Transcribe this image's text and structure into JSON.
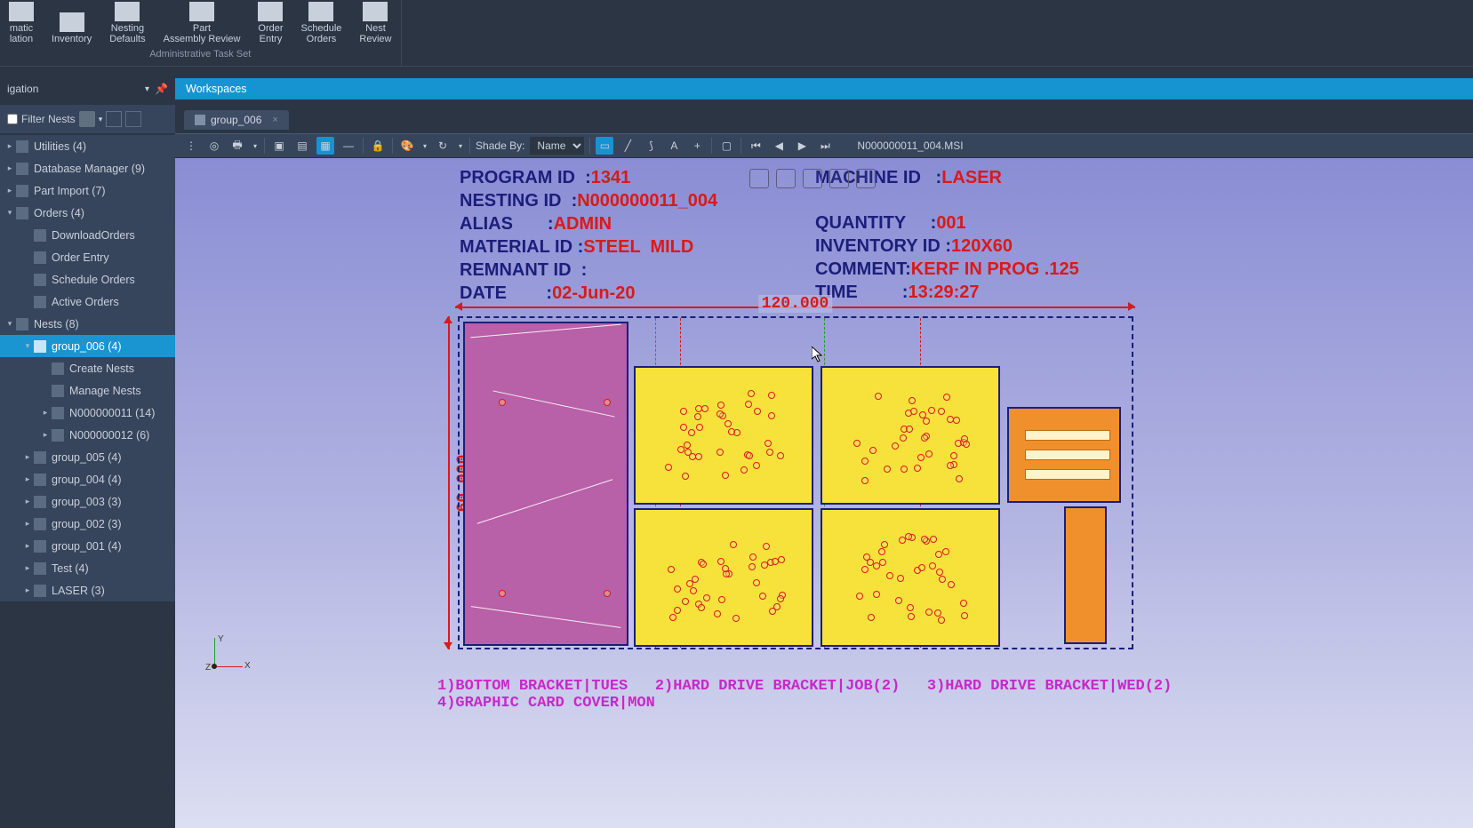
{
  "ribbon": {
    "items": [
      {
        "label": "matic\nlation"
      },
      {
        "label": "Inventory"
      },
      {
        "label": "Nesting\nDefaults"
      },
      {
        "label": "Part\nAssembly Review"
      },
      {
        "label": "Order\nEntry"
      },
      {
        "label": "Schedule\nOrders"
      },
      {
        "label": "Nest\nReview"
      }
    ],
    "group_label": "Administrative Task Set"
  },
  "nav": {
    "title": "igation",
    "filter_label": "Filter Nests"
  },
  "tree": [
    {
      "d": 0,
      "exp": "▸",
      "label": "Utilities (4)"
    },
    {
      "d": 0,
      "exp": "▸",
      "label": "Database Manager (9)"
    },
    {
      "d": 0,
      "exp": "▸",
      "label": "Part Import (7)"
    },
    {
      "d": 0,
      "exp": "▾",
      "label": "Orders (4)"
    },
    {
      "d": 1,
      "exp": "",
      "label": "DownloadOrders"
    },
    {
      "d": 1,
      "exp": "",
      "label": "Order Entry"
    },
    {
      "d": 1,
      "exp": "",
      "label": "Schedule Orders"
    },
    {
      "d": 1,
      "exp": "",
      "label": "Active Orders"
    },
    {
      "d": 0,
      "exp": "▾",
      "label": "Nests (8)"
    },
    {
      "d": 1,
      "exp": "▾",
      "label": "group_006 (4)",
      "sel": true
    },
    {
      "d": 2,
      "exp": "",
      "label": "Create Nests"
    },
    {
      "d": 2,
      "exp": "",
      "label": "Manage Nests"
    },
    {
      "d": 2,
      "exp": "▸",
      "label": "N000000011 (14)"
    },
    {
      "d": 2,
      "exp": "▸",
      "label": "N000000012 (6)"
    },
    {
      "d": 1,
      "exp": "▸",
      "label": "group_005 (4)"
    },
    {
      "d": 1,
      "exp": "▸",
      "label": "group_004 (4)"
    },
    {
      "d": 1,
      "exp": "▸",
      "label": "group_003 (3)"
    },
    {
      "d": 1,
      "exp": "▸",
      "label": "group_002 (3)"
    },
    {
      "d": 1,
      "exp": "▸",
      "label": "group_001 (4)"
    },
    {
      "d": 1,
      "exp": "▸",
      "label": "Test (4)"
    },
    {
      "d": 1,
      "exp": "▸",
      "label": "LASER (3)"
    }
  ],
  "workspaces_tab": "Workspaces",
  "file_tab": "group_006",
  "toolbar": {
    "shade_label": "Shade By:",
    "shade_value": "Name",
    "filename": "N000000011_004.MSI"
  },
  "info": {
    "program_id_k": "PROGRAM ID  :",
    "program_id_v": "1341",
    "nesting_id_k": "NESTING ID  :",
    "nesting_id_v": "N000000011_004",
    "alias_k": "ALIAS       :",
    "alias_v": "ADMIN",
    "material_k": "MATERIAL ID :",
    "material_v": "STEEL  MILD",
    "remnant_k": "REMNANT ID  :",
    "date_k": "DATE        :",
    "date_v": "02-Jun-20",
    "machine_k": "MACHINE ID   :",
    "machine_v": "LASER",
    "qty_k": "QUANTITY     :",
    "qty_v": "001",
    "inv_k": "INVENTORY ID :",
    "inv_v": "120X60",
    "comment_k": "COMMENT:",
    "comment_v": "KERF IN PROG .125",
    "time_k": "TIME         :",
    "time_v": "13:29:27"
  },
  "dims": {
    "width": "120.000",
    "height": "60.000"
  },
  "legend": "1)BOTTOM BRACKET|TUES   2)HARD DRIVE BRACKET|JOB(2)   3)HARD DRIVE BRACKET|WED(2)\n4)GRAPHIC CARD COVER|MON",
  "gizmo": {
    "x": "X",
    "y": "Y",
    "z": "Z"
  }
}
